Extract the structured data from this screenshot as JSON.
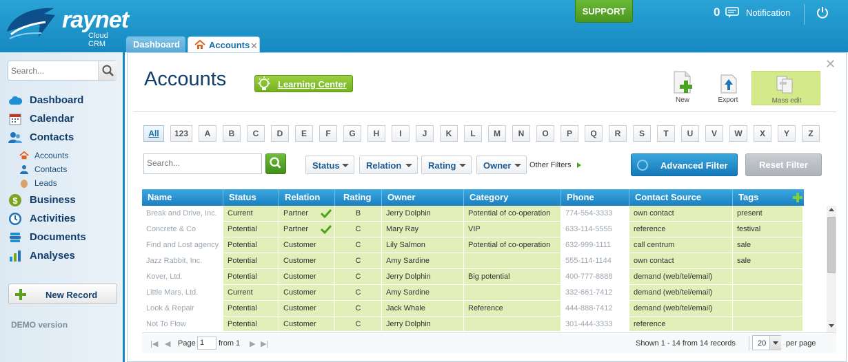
{
  "header": {
    "logo_text": "raynet",
    "logo_sub": "Cloud CRM",
    "support_label": "SUPPORT",
    "notification_count": "0",
    "notification_label": "Notification"
  },
  "tabs": [
    {
      "label": "Dashboard"
    },
    {
      "label": "Accounts",
      "close": "✕"
    }
  ],
  "sidebar": {
    "search_placeholder": "Search...",
    "nav": [
      {
        "label": "Dashboard",
        "icon": "cloud-icon"
      },
      {
        "label": "Calendar",
        "icon": "calendar-icon"
      },
      {
        "label": "Contacts",
        "icon": "contacts-icon"
      }
    ],
    "subnav": [
      {
        "label": "Accounts",
        "icon": "home-icon"
      },
      {
        "label": "Contacts",
        "icon": "person-icon"
      },
      {
        "label": "Leads",
        "icon": "egg-icon"
      }
    ],
    "nav2": [
      {
        "label": "Business",
        "icon": "dollar-icon"
      },
      {
        "label": "Activities",
        "icon": "clock-icon"
      },
      {
        "label": "Documents",
        "icon": "documents-icon"
      },
      {
        "label": "Analyses",
        "icon": "bar-chart-icon"
      }
    ],
    "new_record_label": "New Record",
    "demo_label": "DEMO version"
  },
  "main": {
    "title": "Accounts",
    "learning_center_label": "Learning Center",
    "tools": {
      "new_label": "New",
      "export_label": "Export",
      "mass_edit_label": "Mass edit"
    },
    "alphabet": [
      "All",
      "123",
      "A",
      "B",
      "C",
      "D",
      "E",
      "F",
      "G",
      "H",
      "I",
      "J",
      "K",
      "L",
      "M",
      "N",
      "O",
      "P",
      "Q",
      "R",
      "S",
      "T",
      "U",
      "V",
      "W",
      "X",
      "Y",
      "Z"
    ],
    "filters": {
      "search_placeholder": "Search...",
      "status_label": "Status",
      "relation_label": "Relation",
      "rating_label": "Rating",
      "owner_label": "Owner",
      "other_filters_label": "Other Filters",
      "advanced_filter_label": "Advanced Filter",
      "reset_filter_label": "Reset Filter"
    },
    "table": {
      "columns": [
        "Name",
        "Status",
        "Relation",
        "Rating",
        "Owner",
        "Category",
        "Phone",
        "Contact Source",
        "Tags"
      ],
      "rows": [
        {
          "name": "Break and Drive, Inc.",
          "status": "Current",
          "relation": "Partner",
          "verified": true,
          "rating": "B",
          "owner": "Jerry Dolphin",
          "category": "Potential of co-operation",
          "phone": "774-554-3333",
          "source": "own contact",
          "tags": "present"
        },
        {
          "name": "Concrete & Co",
          "status": "Potential",
          "relation": "Partner",
          "verified": true,
          "rating": "C",
          "owner": "Mary Ray",
          "category": "VIP",
          "phone": "633-114-5555",
          "source": "reference",
          "tags": "festival"
        },
        {
          "name": "Find and Lost agency",
          "status": "Potential",
          "relation": "Customer",
          "verified": false,
          "rating": "C",
          "owner": "Lily Salmon",
          "category": "Potential of co-operation",
          "phone": "632-999-1111",
          "source": "call centrum",
          "tags": "sale"
        },
        {
          "name": "Jazz Rabbit, Inc.",
          "status": "Potential",
          "relation": "Customer",
          "verified": false,
          "rating": "C",
          "owner": "Amy Sardine",
          "category": "",
          "phone": "555-114-1144",
          "source": "own contact",
          "tags": "sale"
        },
        {
          "name": "Kover, Ltd.",
          "status": "Potential",
          "relation": "Customer",
          "verified": false,
          "rating": "C",
          "owner": "Jerry Dolphin",
          "category": "Big potential",
          "phone": "400-777-8888",
          "source": "demand (web/tel/email)",
          "tags": ""
        },
        {
          "name": "Little Mars, Ltd.",
          "status": "Current",
          "relation": "Customer",
          "verified": false,
          "rating": "C",
          "owner": "Amy Sardine",
          "category": "",
          "phone": "332-661-7412",
          "source": "demand (web/tel/email)",
          "tags": ""
        },
        {
          "name": "Look & Repair",
          "status": "Potential",
          "relation": "Customer",
          "verified": false,
          "rating": "C",
          "owner": "Jack Whale",
          "category": "Reference",
          "phone": "444-888-7412",
          "source": "demand (web/tel/email)",
          "tags": ""
        },
        {
          "name": "Not To Flow",
          "status": "Potential",
          "relation": "Customer",
          "verified": false,
          "rating": "C",
          "owner": "Jerry Dolphin",
          "category": "",
          "phone": "301-444-3333",
          "source": "reference",
          "tags": ""
        }
      ]
    },
    "pager": {
      "page_label": "Page",
      "page_value": "1",
      "from_label": "from 1",
      "shown_label": "Shown 1 - 14 from 14 records",
      "page_size": "20",
      "per_page_label": "per page"
    }
  },
  "colors": {
    "header_blue": "#1689c1",
    "accent_green": "#5aa21e",
    "row_green": "#e2efb8",
    "title_navy": "#123e6b"
  }
}
